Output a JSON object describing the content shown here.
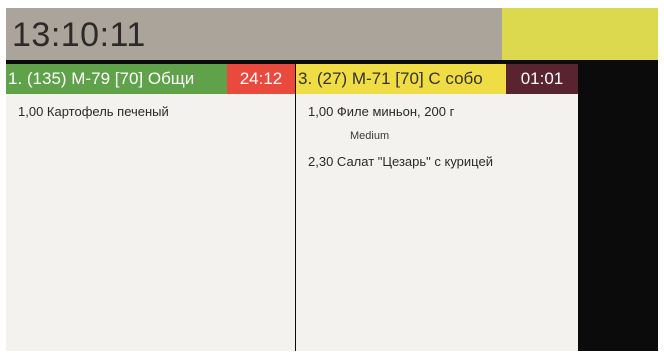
{
  "header": {
    "clock": "13:10:11",
    "accent_color": "#dcd94e"
  },
  "orders": [
    {
      "title": "1. (135) М-79 [70] Общи",
      "timer": "24:12",
      "title_color": "#5fa24a",
      "timer_color": "#e94a3d",
      "items": [
        {
          "text": "1,00 Картофель печеный"
        }
      ]
    },
    {
      "title": "3. (27) М-71 [70] С собо",
      "timer": "01:01",
      "title_color": "#f0dc44",
      "timer_color": "#5a2330",
      "items": [
        {
          "text": "1,00 Филе миньон, 200 г"
        },
        {
          "modifier": "Medium"
        },
        {
          "text": "2,30 Салат \"Цезарь\" с курицей"
        }
      ]
    }
  ]
}
